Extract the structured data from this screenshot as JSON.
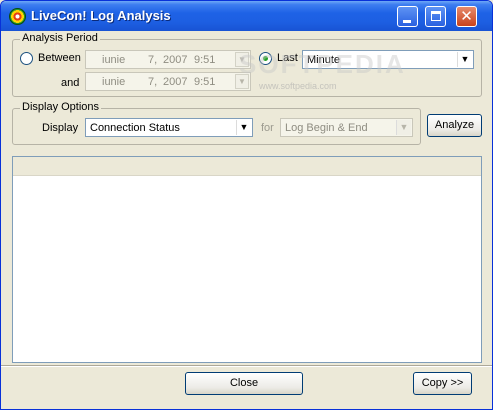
{
  "window": {
    "title": "LiveCon! Log Analysis"
  },
  "analysis_period": {
    "legend": "Analysis Period",
    "between_label": "Between",
    "and_label": "and",
    "from": {
      "month": "iunie",
      "day": "7,",
      "year": "2007",
      "time": "9:51"
    },
    "to": {
      "month": "iunie",
      "day": "7,",
      "year": "2007",
      "time": "9:51"
    },
    "last_label": "Last",
    "last_value": "Minute"
  },
  "display_options": {
    "legend": "Display Options",
    "display_label": "Display",
    "display_value": "Connection Status",
    "for_label": "for",
    "for_value": "Log Begin & End"
  },
  "buttons": {
    "analyze": "Analyze",
    "close": "Close",
    "copy": "Copy >>"
  },
  "watermark": {
    "text": "SOFTPEDIA",
    "url": "www.softpedia.com"
  },
  "icons": {
    "dropdown": "▼",
    "close": "✕"
  }
}
